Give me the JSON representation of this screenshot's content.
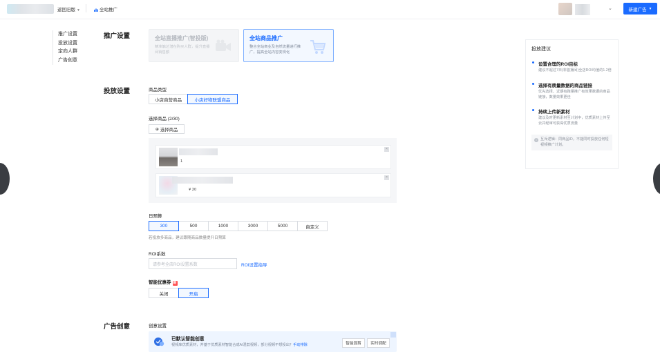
{
  "header": {
    "back_label": "返回旧版",
    "crumb_label": "全站推广",
    "new_button_label": "新建广告",
    "colors": {
      "brand": "#1a6bff"
    }
  },
  "leftnav": {
    "items": [
      {
        "label": "推广设置"
      },
      {
        "label": "投放设置"
      },
      {
        "label": "定向人群"
      },
      {
        "label": "广告创意"
      }
    ]
  },
  "promo_section": {
    "title": "推广设置",
    "cards": [
      {
        "title": "全站直播推广(智投版)",
        "desc": "精准触达潜在购买人群，提升直播间销售额",
        "icon": "camera-icon",
        "selected": false
      },
      {
        "title": "全站商品推广",
        "desc": "整合全站商业及自然流量进行推广，提高全站内容变现化",
        "icon": "cart-icon",
        "selected": true
      }
    ]
  },
  "delivery_section": {
    "title": "投放设置",
    "product_type": {
      "label": "商品类型",
      "options": [
        "小店自营商品",
        "小店好物联盟商品"
      ],
      "selected_index": 1
    },
    "select_goods": {
      "label": "选择商品 (2/30)",
      "add_button": "选择商品",
      "items": [
        {
          "meta": "1"
        },
        {
          "meta": "¥ 20"
        }
      ]
    },
    "budget": {
      "label": "日预算",
      "options": [
        "300",
        "500",
        "1000",
        "3000",
        "5000",
        "自定义"
      ],
      "selected_index": 0,
      "hint": "若投放多商品，建议跟随商品数量提升日预算"
    },
    "roi": {
      "label": "ROI系数",
      "placeholder": "请参考全店ROI设置系数",
      "link": "ROI设置指导"
    },
    "coupon": {
      "label": "智能优惠券",
      "badge": "新",
      "options": [
        "关闭",
        "开启"
      ],
      "selected_index": 1
    }
  },
  "creative_section": {
    "title": "广告创意",
    "settings_label": "创意设置",
    "smart": {
      "title": "已默认智能创意",
      "desc": "视频库优质素材，并基于优质素材智能合成AI混剪视频，",
      "desc_question": "部分视频不想投出？",
      "desc_link": "手动排除",
      "btn_preview": "智能混剪",
      "btn_adjust": "实时调配"
    }
  },
  "advice": {
    "title": "投放建议",
    "items": [
      {
        "heading": "设置合理的ROI目标",
        "body": "建议不超过7日(非首播间)全店ROI均值的1.2倍"
      },
      {
        "heading": "选择有质量数据的商品链接",
        "body": "优先选择、近期有跑量推广有效果数据的商品链接，数量效果更佳"
      },
      {
        "heading": "持续上传新素材",
        "body": "建议及时更新素材至计划中，优质素材上传至云并经审可获得优质流量"
      }
    ],
    "note": "互斥逻辑：同商品ID，不能同时投放任何短视频推广计划。"
  }
}
